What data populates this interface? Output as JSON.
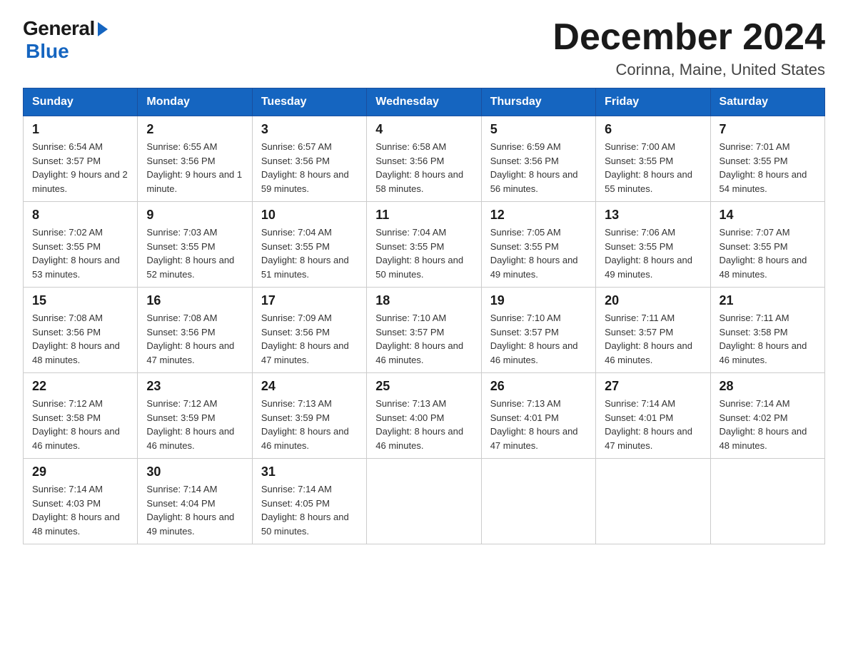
{
  "logo": {
    "general": "General",
    "blue": "Blue"
  },
  "title": "December 2024",
  "subtitle": "Corinna, Maine, United States",
  "headers": [
    "Sunday",
    "Monday",
    "Tuesday",
    "Wednesday",
    "Thursday",
    "Friday",
    "Saturday"
  ],
  "weeks": [
    [
      {
        "day": "1",
        "sunrise": "6:54 AM",
        "sunset": "3:57 PM",
        "daylight": "9 hours and 2 minutes."
      },
      {
        "day": "2",
        "sunrise": "6:55 AM",
        "sunset": "3:56 PM",
        "daylight": "9 hours and 1 minute."
      },
      {
        "day": "3",
        "sunrise": "6:57 AM",
        "sunset": "3:56 PM",
        "daylight": "8 hours and 59 minutes."
      },
      {
        "day": "4",
        "sunrise": "6:58 AM",
        "sunset": "3:56 PM",
        "daylight": "8 hours and 58 minutes."
      },
      {
        "day": "5",
        "sunrise": "6:59 AM",
        "sunset": "3:56 PM",
        "daylight": "8 hours and 56 minutes."
      },
      {
        "day": "6",
        "sunrise": "7:00 AM",
        "sunset": "3:55 PM",
        "daylight": "8 hours and 55 minutes."
      },
      {
        "day": "7",
        "sunrise": "7:01 AM",
        "sunset": "3:55 PM",
        "daylight": "8 hours and 54 minutes."
      }
    ],
    [
      {
        "day": "8",
        "sunrise": "7:02 AM",
        "sunset": "3:55 PM",
        "daylight": "8 hours and 53 minutes."
      },
      {
        "day": "9",
        "sunrise": "7:03 AM",
        "sunset": "3:55 PM",
        "daylight": "8 hours and 52 minutes."
      },
      {
        "day": "10",
        "sunrise": "7:04 AM",
        "sunset": "3:55 PM",
        "daylight": "8 hours and 51 minutes."
      },
      {
        "day": "11",
        "sunrise": "7:04 AM",
        "sunset": "3:55 PM",
        "daylight": "8 hours and 50 minutes."
      },
      {
        "day": "12",
        "sunrise": "7:05 AM",
        "sunset": "3:55 PM",
        "daylight": "8 hours and 49 minutes."
      },
      {
        "day": "13",
        "sunrise": "7:06 AM",
        "sunset": "3:55 PM",
        "daylight": "8 hours and 49 minutes."
      },
      {
        "day": "14",
        "sunrise": "7:07 AM",
        "sunset": "3:55 PM",
        "daylight": "8 hours and 48 minutes."
      }
    ],
    [
      {
        "day": "15",
        "sunrise": "7:08 AM",
        "sunset": "3:56 PM",
        "daylight": "8 hours and 48 minutes."
      },
      {
        "day": "16",
        "sunrise": "7:08 AM",
        "sunset": "3:56 PM",
        "daylight": "8 hours and 47 minutes."
      },
      {
        "day": "17",
        "sunrise": "7:09 AM",
        "sunset": "3:56 PM",
        "daylight": "8 hours and 47 minutes."
      },
      {
        "day": "18",
        "sunrise": "7:10 AM",
        "sunset": "3:57 PM",
        "daylight": "8 hours and 46 minutes."
      },
      {
        "day": "19",
        "sunrise": "7:10 AM",
        "sunset": "3:57 PM",
        "daylight": "8 hours and 46 minutes."
      },
      {
        "day": "20",
        "sunrise": "7:11 AM",
        "sunset": "3:57 PM",
        "daylight": "8 hours and 46 minutes."
      },
      {
        "day": "21",
        "sunrise": "7:11 AM",
        "sunset": "3:58 PM",
        "daylight": "8 hours and 46 minutes."
      }
    ],
    [
      {
        "day": "22",
        "sunrise": "7:12 AM",
        "sunset": "3:58 PM",
        "daylight": "8 hours and 46 minutes."
      },
      {
        "day": "23",
        "sunrise": "7:12 AM",
        "sunset": "3:59 PM",
        "daylight": "8 hours and 46 minutes."
      },
      {
        "day": "24",
        "sunrise": "7:13 AM",
        "sunset": "3:59 PM",
        "daylight": "8 hours and 46 minutes."
      },
      {
        "day": "25",
        "sunrise": "7:13 AM",
        "sunset": "4:00 PM",
        "daylight": "8 hours and 46 minutes."
      },
      {
        "day": "26",
        "sunrise": "7:13 AM",
        "sunset": "4:01 PM",
        "daylight": "8 hours and 47 minutes."
      },
      {
        "day": "27",
        "sunrise": "7:14 AM",
        "sunset": "4:01 PM",
        "daylight": "8 hours and 47 minutes."
      },
      {
        "day": "28",
        "sunrise": "7:14 AM",
        "sunset": "4:02 PM",
        "daylight": "8 hours and 48 minutes."
      }
    ],
    [
      {
        "day": "29",
        "sunrise": "7:14 AM",
        "sunset": "4:03 PM",
        "daylight": "8 hours and 48 minutes."
      },
      {
        "day": "30",
        "sunrise": "7:14 AM",
        "sunset": "4:04 PM",
        "daylight": "8 hours and 49 minutes."
      },
      {
        "day": "31",
        "sunrise": "7:14 AM",
        "sunset": "4:05 PM",
        "daylight": "8 hours and 50 minutes."
      },
      null,
      null,
      null,
      null
    ]
  ]
}
